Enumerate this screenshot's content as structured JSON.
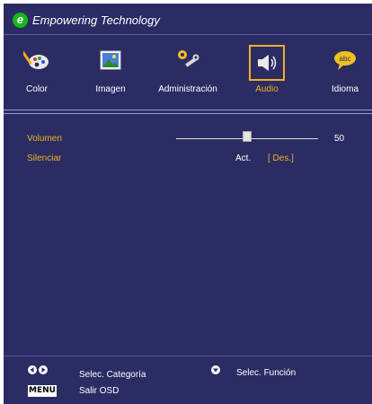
{
  "header": {
    "title": "Empowering Technology",
    "logo_letter": "e"
  },
  "tabs": [
    {
      "label": "Color",
      "icon": "palette-icon",
      "active": false
    },
    {
      "label": "Imagen",
      "icon": "picture-icon",
      "active": false
    },
    {
      "label": "Administración",
      "icon": "tools-icon",
      "active": false
    },
    {
      "label": "Audio",
      "icon": "speaker-icon",
      "active": true
    },
    {
      "label": "Idioma",
      "icon": "speech-bubble-icon",
      "active": false
    }
  ],
  "settings": {
    "volume": {
      "label": "Volumen",
      "value": "50",
      "level": 0.5
    },
    "mute": {
      "label": "Silenciar",
      "options": [
        "Act.",
        "[ Des.]"
      ],
      "selected": "[ Des.]"
    }
  },
  "footer": {
    "select_category": "Selec. Categoría",
    "select_function": "Selec. Función",
    "menu_key": "MENU",
    "exit": "Salir OSD"
  },
  "colors": {
    "background": "#2b2c64",
    "accent": "#f0b020",
    "text": "#ffffff"
  }
}
